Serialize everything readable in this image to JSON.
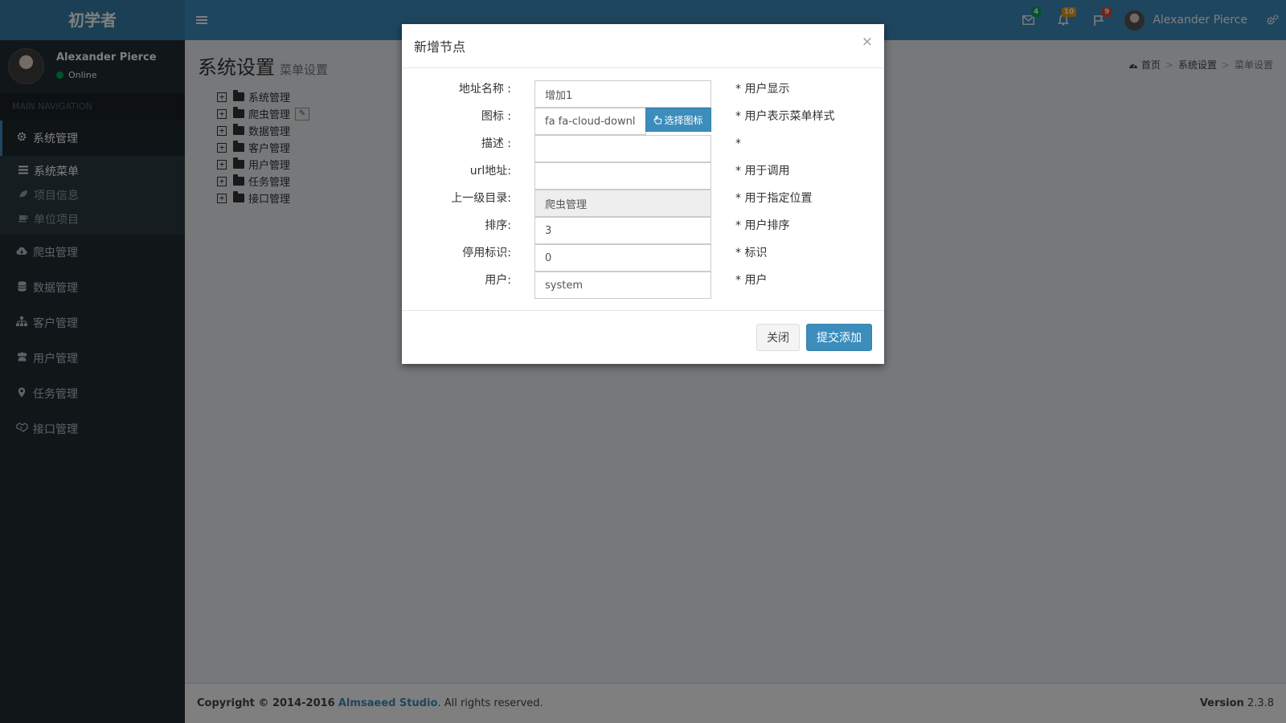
{
  "app": {
    "logo": "初学者"
  },
  "header": {
    "mail_count": "4",
    "bell_count": "10",
    "flag_count": "9",
    "user_name": "Alexander Pierce",
    "colors": {
      "bar": "#3c8dbc",
      "logo": "#367fa9",
      "green": "#00a65a",
      "orange": "#f39c12",
      "red": "#dd4b39"
    }
  },
  "sidebar": {
    "user_name": "Alexander Pierce",
    "status": "Online",
    "nav_header": "MAIN NAVIGATION",
    "menu": [
      {
        "label": "系统管理",
        "icon": "gear-icon"
      },
      {
        "label": "爬虫管理",
        "icon": "cloud-download-icon"
      },
      {
        "label": "数据管理",
        "icon": "database-icon"
      },
      {
        "label": "客户管理",
        "icon": "sitemap-icon"
      },
      {
        "label": "用户管理",
        "icon": "users-icon"
      },
      {
        "label": "任务管理",
        "icon": "map-marker-icon"
      },
      {
        "label": "接口管理",
        "icon": "handshake-icon"
      }
    ],
    "submenu": [
      {
        "label": "系统菜单",
        "icon": "bars-icon"
      },
      {
        "label": "项目信息",
        "icon": "leaf-icon"
      },
      {
        "label": "单位项目",
        "icon": "coffee-icon"
      }
    ]
  },
  "content": {
    "title": "系统设置",
    "subtitle": "菜单设置",
    "breadcrumb": [
      "首页",
      "系统设置",
      "菜单设置"
    ],
    "tree": [
      "系统管理",
      "爬虫管理",
      "数据管理",
      "客户管理",
      "用户管理",
      "任务管理",
      "接口管理"
    ]
  },
  "modal": {
    "title": "新增节点",
    "close_symbol": "×",
    "fields": {
      "name": {
        "label": "地址名称 :",
        "value": "增加1",
        "hint": "* 用户显示"
      },
      "icon": {
        "label": "图标 :",
        "value": "fa fa-cloud-download",
        "hint": "* 用户表示菜单样式",
        "button": "选择图标"
      },
      "desc": {
        "label": "描述 :",
        "value": "",
        "hint": "*"
      },
      "url": {
        "label": "url地址:",
        "value": "",
        "hint": "* 用于调用"
      },
      "parent": {
        "label": "上一级目录:",
        "value": "爬虫管理",
        "hint": "* 用于指定位置"
      },
      "order": {
        "label": "排序:",
        "value": "3",
        "hint": "* 用户排序"
      },
      "disabled": {
        "label": "停用标识:",
        "value": "0",
        "hint": "* 标识"
      },
      "user": {
        "label": "用户:",
        "value": "system",
        "hint": "* 用户"
      }
    },
    "buttons": {
      "close": "关闭",
      "submit": "提交添加"
    }
  },
  "footer": {
    "copyright": "Copyright © 2014-2016",
    "company": "Almsaeed Studio",
    "rights": ". All rights reserved.",
    "version_label": "Version",
    "version": "2.3.8"
  }
}
